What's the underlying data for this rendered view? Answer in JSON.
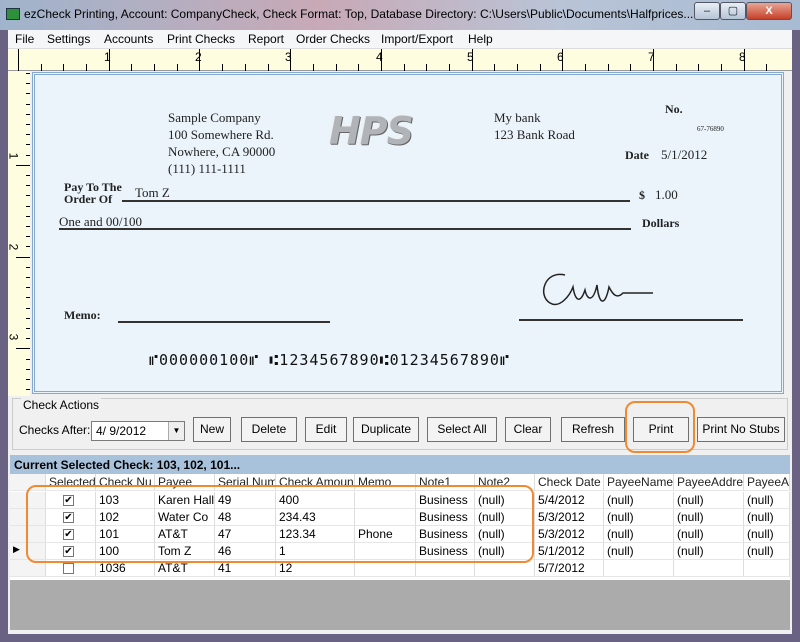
{
  "window": {
    "title": "ezCheck Printing, Account: CompanyCheck, Check Format: Top, Database Directory: C:\\Users\\Public\\Documents\\Halfprices...",
    "minimize": "‒",
    "maximize": "▢",
    "close": "X"
  },
  "menu": [
    "File",
    "Settings",
    "Accounts",
    "Print Checks",
    "Report",
    "Order Checks",
    "Import/Export",
    "Help"
  ],
  "ruler": {
    "top": [
      "1",
      "2",
      "3",
      "4",
      "5",
      "6",
      "7",
      "8"
    ],
    "left": [
      "1",
      "2",
      "3"
    ]
  },
  "check": {
    "company": [
      "Sample Company",
      "100 Somewhere Rd.",
      "Nowhere, CA 90000",
      "(111) 111-1111"
    ],
    "logo": "HPS",
    "bank": [
      "My bank",
      "123 Bank Road"
    ],
    "no_label": "No.",
    "routing_fraction": "67-76890",
    "date_label": "Date",
    "date": "5/1/2012",
    "pay_to_label_1": "Pay To The",
    "pay_to_label_2": "Order Of",
    "payee": "Tom Z",
    "currency": "$",
    "amount": "1.00",
    "amount_words": "One and 00/100",
    "dollars_label": "Dollars",
    "memo_label": "Memo:",
    "micr": "⑈000000100⑈ ⑆1234567890⑆01234567890⑈"
  },
  "actions": {
    "group_label": "Check Actions",
    "checks_after_label": "Checks After:",
    "checks_after_value": "4/ 9/2012",
    "buttons": [
      "New",
      "Delete",
      "Edit",
      "Duplicate",
      "Select All",
      "Clear",
      "Refresh",
      "Print",
      "Print No Stubs"
    ]
  },
  "grid": {
    "title": "Current Selected Check: 103, 102, 101...",
    "columns": [
      "Selected",
      "Check Nu",
      "Payee",
      "Serial Num",
      "Check Amount",
      "Memo",
      "Note1",
      "Note2",
      "Check Date",
      "PayeeName",
      "PayeeAddre",
      "PayeeAc"
    ],
    "rows": [
      {
        "selected": true,
        "cells": [
          "103",
          "Karen Hall",
          "49",
          "400",
          "",
          "Business",
          "(null)",
          "5/4/2012",
          "(null)",
          "(null)",
          "(null)"
        ]
      },
      {
        "selected": true,
        "cells": [
          "102",
          "Water Co",
          "48",
          "234.43",
          "",
          "Business",
          "(null)",
          "5/3/2012",
          "(null)",
          "(null)",
          "(null)"
        ]
      },
      {
        "selected": true,
        "cells": [
          "101",
          "AT&T",
          "47",
          "123.34",
          "Phone",
          "Business",
          "(null)",
          "5/3/2012",
          "(null)",
          "(null)",
          "(null)"
        ]
      },
      {
        "selected": true,
        "current": true,
        "cells": [
          "100",
          "Tom Z",
          "46",
          "1",
          "",
          "Business",
          "(null)",
          "5/1/2012",
          "(null)",
          "(null)",
          "(null)"
        ]
      },
      {
        "selected": false,
        "cells": [
          "1036",
          "AT&T",
          "41",
          "12",
          "",
          "",
          "",
          "5/7/2012",
          "",
          "",
          ""
        ]
      }
    ]
  },
  "colors": {
    "highlight": "#f08a32",
    "check_bg": "#eaf4fa",
    "ruler_bg": "#fffde0",
    "grid_header": "#a8c2dc"
  }
}
